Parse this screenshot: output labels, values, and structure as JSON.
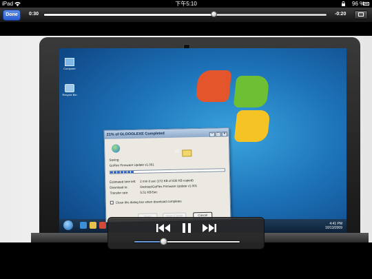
{
  "status_bar": {
    "carrier": "iPad",
    "time": "下午5:10",
    "battery_percent": "96 %",
    "icons": [
      "wifi-icon",
      "lock-icon",
      "battery-icon"
    ]
  },
  "player": {
    "done_label": "Done",
    "elapsed": "0:30",
    "remaining": "-0:20",
    "progress": 0.6,
    "volume": 0.28,
    "accent_color": "#2a5bd1",
    "icons": [
      "aspect-ratio-icon",
      "rewind-icon",
      "pause-icon",
      "fast-forward-icon"
    ]
  },
  "video": {
    "desktop_icons": [
      "Computer",
      "Recycle Bin"
    ],
    "tray_clock": [
      "4:41 PM",
      "10/13/2009"
    ],
    "dialog": {
      "title": "21% of GLOOOLEXE Completed",
      "filename": "GoFlex Firmware Update v1.001",
      "saving_label": "Saving:",
      "progress": 0.21,
      "rows": [
        {
          "label": "Estimated time left:",
          "value": "2 min 8 sec (172 KB of 836 KB copied)"
        },
        {
          "label": "Download to:",
          "value": "Desktop\\GoFlex Firmware Update v1.001"
        },
        {
          "label": "Transfer rate:",
          "value": "5.51 KB/Sec"
        }
      ],
      "close_checkbox_label": "Close this dialog box when download completes",
      "buttons": [
        "Open",
        "Open Folder",
        "Cancel"
      ]
    }
  }
}
